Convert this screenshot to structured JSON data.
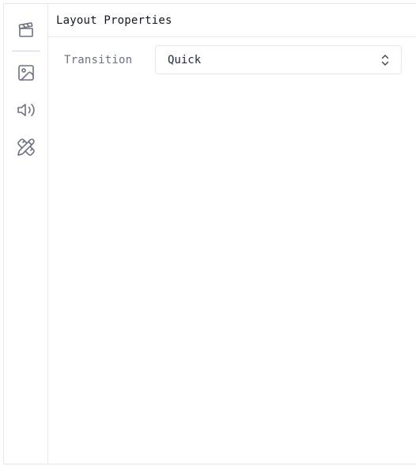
{
  "sidebar": {
    "icons": [
      "clapperboard-icon",
      "image-icon",
      "speaker-icon",
      "pencil-ruler-icon"
    ]
  },
  "panel": {
    "title": "Layout Properties",
    "fields": [
      {
        "label": "Transition",
        "value": "Quick"
      }
    ]
  },
  "colors": {
    "border": "#e5e7eb",
    "icon": "#6b7280",
    "text": "#111827",
    "label": "#6b7280"
  }
}
